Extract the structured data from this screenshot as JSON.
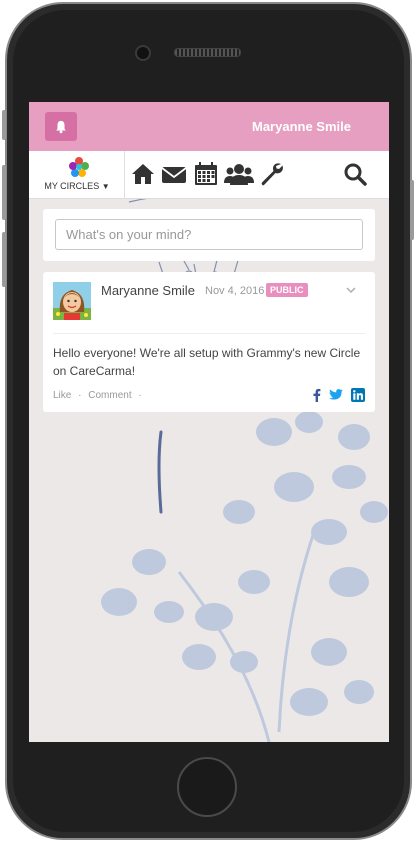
{
  "header": {
    "user_name": "Maryanne Smile",
    "accent": "#e79fc1",
    "bell_color": "#d670a4"
  },
  "nav": {
    "circles_label": "MY CIRCLES",
    "icons": [
      "home-icon",
      "envelope-icon",
      "calendar-icon",
      "users-icon",
      "wrench-icon",
      "search-icon"
    ]
  },
  "composer": {
    "placeholder": "What's on your mind?"
  },
  "post": {
    "author": "Maryanne Smile",
    "date": "Nov 4, 2016",
    "visibility": "PUBLIC",
    "body": "Hello everyone! We're all setup with Grammy's new Circle on CareCarma!",
    "like_label": "Like",
    "comment_label": "Comment",
    "separator": "·",
    "share_icons": [
      "facebook-icon",
      "twitter-icon",
      "linkedin-icon"
    ],
    "brand_colors": {
      "facebook": "#3b5998",
      "twitter": "#1da1f2",
      "linkedin": "#0077b5"
    }
  }
}
